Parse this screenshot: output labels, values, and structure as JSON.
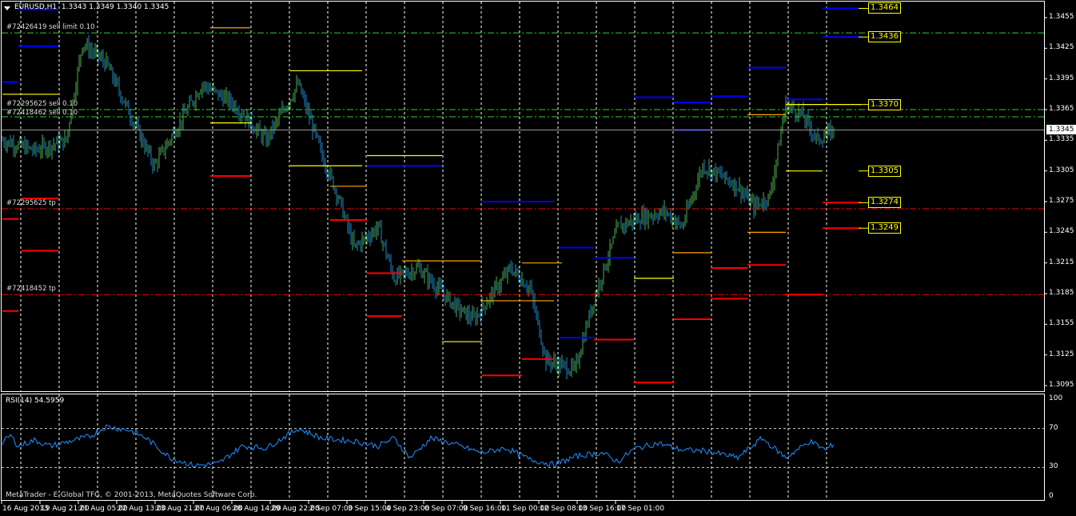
{
  "header": {
    "symbol": "EURUSD,H1",
    "ohlc": "1.3343 1.3349 1.3340 1.3345"
  },
  "copyright": "MetaTrader - E-Global TFG, © 2001-2013, MetaQuotes Software Corp.",
  "colors": {
    "bg": "#000000",
    "up": "#4caf50",
    "down": "#1e88c8",
    "rsi": "#1e90ff",
    "grid": "#ffffff",
    "sell": "#32cd32",
    "tp": "#ff0000"
  },
  "chart_data": [
    {
      "type": "candlestick",
      "title": "EURUSD,H1",
      "ylim": [
        1.3085,
        1.3475
      ],
      "yticks": [
        "1.3455",
        "1.3425",
        "1.3395",
        "1.3365",
        "1.3335",
        "1.3305",
        "1.3275",
        "1.3245",
        "1.3215",
        "1.3185",
        "1.3155",
        "1.3125",
        "1.3095"
      ],
      "xticks": [
        "16 Aug 2013",
        "19 Aug 21:00",
        "21 Aug 05:00",
        "22 Aug 13:00",
        "23 Aug 21:00",
        "27 Aug 06:00",
        "28 Aug 14:00",
        "29 Aug 22:00",
        "2 Sep 07:00",
        "3 Sep 15:00",
        "4 Sep 23:00",
        "6 Sep 07:00",
        "9 Sep 16:00",
        "11 Sep 00:00",
        "12 Sep 08:00",
        "13 Sep 16:00",
        "17 Sep 01:00"
      ],
      "current_price": "1.3345",
      "close_path": [
        [
          0,
          1.3335
        ],
        [
          20,
          1.3325
        ],
        [
          40,
          1.3335
        ],
        [
          50,
          1.343
        ],
        [
          65,
          1.341
        ],
        [
          80,
          1.336
        ],
        [
          95,
          1.331
        ],
        [
          110,
          1.335
        ],
        [
          125,
          1.339
        ],
        [
          145,
          1.337
        ],
        [
          165,
          1.3335
        ],
        [
          185,
          1.339
        ],
        [
          200,
          1.332
        ],
        [
          210,
          1.328
        ],
        [
          220,
          1.323
        ],
        [
          235,
          1.325
        ],
        [
          245,
          1.32
        ],
        [
          260,
          1.321
        ],
        [
          285,
          1.317
        ],
        [
          295,
          1.316
        ],
        [
          318,
          1.321
        ],
        [
          330,
          1.319
        ],
        [
          340,
          1.312
        ],
        [
          358,
          1.311
        ],
        [
          370,
          1.318
        ],
        [
          385,
          1.325
        ],
        [
          400,
          1.326
        ],
        [
          415,
          1.3265
        ],
        [
          425,
          1.325
        ],
        [
          438,
          1.331
        ],
        [
          450,
          1.33
        ],
        [
          460,
          1.329
        ],
        [
          470,
          1.327
        ],
        [
          480,
          1.328
        ],
        [
          490,
          1.337
        ],
        [
          500,
          1.336
        ],
        [
          510,
          1.3335
        ],
        [
          520,
          1.3345
        ]
      ],
      "price_labels": [
        "1.3464",
        "1.3436",
        "1.3370",
        "1.3305",
        "1.3274",
        "1.3249"
      ],
      "orders": [
        {
          "label": "#72426419 sell limit 0.10",
          "price": 1.344,
          "kind": "sell"
        },
        {
          "label": "#72295625 sell 0.10",
          "price": 1.3365,
          "kind": "sell"
        },
        {
          "label": "#72418462 sell 0.10",
          "price": 1.3358,
          "kind": "sell"
        },
        {
          "label": "#72295625 tp",
          "price": 1.3268,
          "kind": "tp"
        },
        {
          "label": "#72418452 tp",
          "price": 1.3184,
          "kind": "tp"
        }
      ],
      "levels": [
        [
          0,
          10,
          1.3392,
          "#0000ff"
        ],
        [
          10,
          35,
          1.3463,
          "#0000ff"
        ],
        [
          10,
          35,
          1.3427,
          "#0000ff"
        ],
        [
          0,
          35,
          1.338,
          "#ffff00"
        ],
        [
          12,
          35,
          1.3278,
          "#ff0000"
        ],
        [
          12,
          35,
          1.3227,
          "#ff0000"
        ],
        [
          0,
          10,
          1.3258,
          "#ff0000"
        ],
        [
          0,
          10,
          1.3168,
          "#ff0000"
        ],
        [
          130,
          155,
          1.3445,
          "#ffa500"
        ],
        [
          130,
          155,
          1.3352,
          "#ffff00"
        ],
        [
          130,
          155,
          1.33,
          "#ff0000"
        ],
        [
          180,
          225,
          1.3403,
          "#ffff00"
        ],
        [
          180,
          225,
          1.331,
          "#ffff00"
        ],
        [
          205,
          228,
          1.329,
          "#ffa500"
        ],
        [
          205,
          228,
          1.3257,
          "#ff0000"
        ],
        [
          228,
          275,
          1.332,
          "#ffff00"
        ],
        [
          228,
          275,
          1.331,
          "#0000ff"
        ],
        [
          228,
          250,
          1.3205,
          "#ff0000"
        ],
        [
          228,
          250,
          1.3163,
          "#ff0000"
        ],
        [
          250,
          300,
          1.3217,
          "#ffa500"
        ],
        [
          275,
          300,
          1.3138,
          "#ffff00"
        ],
        [
          300,
          345,
          1.3275,
          "#0000ff"
        ],
        [
          300,
          345,
          1.3178,
          "#ffa500"
        ],
        [
          300,
          325,
          1.3105,
          "#ff0000"
        ],
        [
          325,
          350,
          1.3215,
          "#ffa500"
        ],
        [
          348,
          370,
          1.323,
          "#0000ff"
        ],
        [
          348,
          370,
          1.3142,
          "#0000ff"
        ],
        [
          325,
          345,
          1.3121,
          "#ff0000"
        ],
        [
          370,
          395,
          1.322,
          "#0000ff"
        ],
        [
          370,
          395,
          1.314,
          "#ff0000"
        ],
        [
          395,
          420,
          1.3377,
          "#0000ff"
        ],
        [
          395,
          420,
          1.32,
          "#ffff00"
        ],
        [
          395,
          420,
          1.3098,
          "#ff0000"
        ],
        [
          420,
          443,
          1.3372,
          "#0000ff"
        ],
        [
          420,
          443,
          1.3345,
          "#0000ff"
        ],
        [
          420,
          443,
          1.3225,
          "#ffa500"
        ],
        [
          420,
          443,
          1.316,
          "#ff0000"
        ],
        [
          443,
          466,
          1.3378,
          "#0000ff"
        ],
        [
          443,
          466,
          1.321,
          "#ff0000"
        ],
        [
          443,
          466,
          1.318,
          "#ff0000"
        ],
        [
          466,
          490,
          1.3406,
          "#0000ff"
        ],
        [
          466,
          490,
          1.336,
          "#ffa500"
        ],
        [
          466,
          490,
          1.3245,
          "#ffa500"
        ],
        [
          466,
          490,
          1.3213,
          "#ff0000"
        ],
        [
          490,
          513,
          1.3375,
          "#0000ff"
        ],
        [
          490,
          513,
          1.3305,
          "#ffff00"
        ],
        [
          490,
          513,
          1.3184,
          "#ff0000"
        ],
        [
          513,
          537,
          1.3464,
          "#0000ff"
        ],
        [
          513,
          537,
          1.3436,
          "#0000ff"
        ],
        [
          490,
          537,
          1.337,
          "#ffff00"
        ],
        [
          513,
          537,
          1.3274,
          "#ff0000"
        ],
        [
          513,
          537,
          1.3249,
          "#ff0000"
        ]
      ]
    },
    {
      "type": "line",
      "title": "RSI(14) 54.5959",
      "ylim": [
        0,
        100
      ],
      "yticks": [
        "100",
        "70",
        "30",
        "0"
      ],
      "values_path": [
        [
          0,
          55
        ],
        [
          5,
          63
        ],
        [
          10,
          52
        ],
        [
          20,
          58
        ],
        [
          30,
          52
        ],
        [
          40,
          56
        ],
        [
          55,
          62
        ],
        [
          65,
          72
        ],
        [
          80,
          68
        ],
        [
          90,
          60
        ],
        [
          105,
          40
        ],
        [
          120,
          32
        ],
        [
          135,
          34
        ],
        [
          150,
          52
        ],
        [
          165,
          50
        ],
        [
          185,
          70
        ],
        [
          200,
          60
        ],
        [
          220,
          57
        ],
        [
          235,
          52
        ],
        [
          245,
          60
        ],
        [
          255,
          40
        ],
        [
          268,
          60
        ],
        [
          280,
          55
        ],
        [
          300,
          45
        ],
        [
          315,
          50
        ],
        [
          330,
          38
        ],
        [
          345,
          33
        ],
        [
          360,
          42
        ],
        [
          375,
          45
        ],
        [
          385,
          36
        ],
        [
          395,
          49
        ],
        [
          410,
          55
        ],
        [
          425,
          48
        ],
        [
          440,
          47
        ],
        [
          460,
          40
        ],
        [
          475,
          60
        ],
        [
          490,
          40
        ],
        [
          505,
          57
        ],
        [
          515,
          48
        ],
        [
          520,
          54.6
        ]
      ]
    }
  ]
}
